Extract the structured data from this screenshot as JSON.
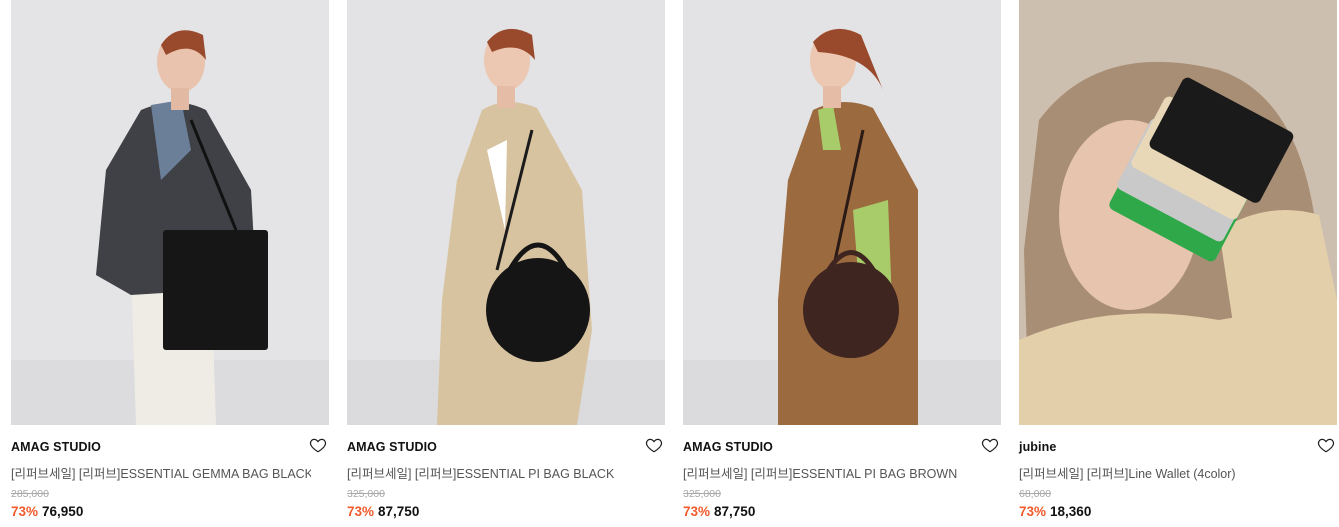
{
  "products": [
    {
      "brand": "AMAG STUDIO",
      "title": "[리퍼브세일] [리퍼브]ESSENTIAL GEMMA BAG BLACK",
      "original_price": "285,000",
      "discount": "73%",
      "sale_price": "76,950",
      "image": "model-navy-coat-black-tote-image",
      "colors": {
        "bg": "#e4e4e6",
        "coat": "#3f4146",
        "bag": "#161616",
        "accent": "#6b7f98",
        "pants": "#efece6"
      }
    },
    {
      "brand": "AMAG STUDIO",
      "title": "[리퍼브세일] [리퍼브]ESSENTIAL PI BAG BLACK",
      "original_price": "325,000",
      "discount": "73%",
      "sale_price": "87,750",
      "image": "model-trench-coat-black-round-bag-image",
      "colors": {
        "bg": "#e3e3e5",
        "coat": "#d8c3a0",
        "bag": "#151515",
        "accent": "#ffffff",
        "pants": "#cdb893"
      }
    },
    {
      "brand": "AMAG STUDIO",
      "title": "[리퍼브세일] [리퍼브]ESSENTIAL PI BAG BROWN",
      "original_price": "325,000",
      "discount": "73%",
      "sale_price": "87,750",
      "image": "model-camel-coat-brown-round-bag-image",
      "colors": {
        "bg": "#e3e3e5",
        "coat": "#9c6a3f",
        "bag": "#3e2520",
        "accent": "#a9cc6a",
        "pants": "#8a5a33"
      }
    },
    {
      "brand": "jubine",
      "title": "[리퍼브세일] [리퍼브]Line Wallet (4color)",
      "original_price": "68,000",
      "discount": "73%",
      "sale_price": "18,360",
      "image": "model-holding-wallets-image",
      "colors": {
        "bg": "#cdbfaf",
        "coat": "#e3cfa9",
        "bag": "#1a1a1a",
        "accent": "#2fa84a",
        "pants": "#c9c9c9"
      }
    }
  ]
}
